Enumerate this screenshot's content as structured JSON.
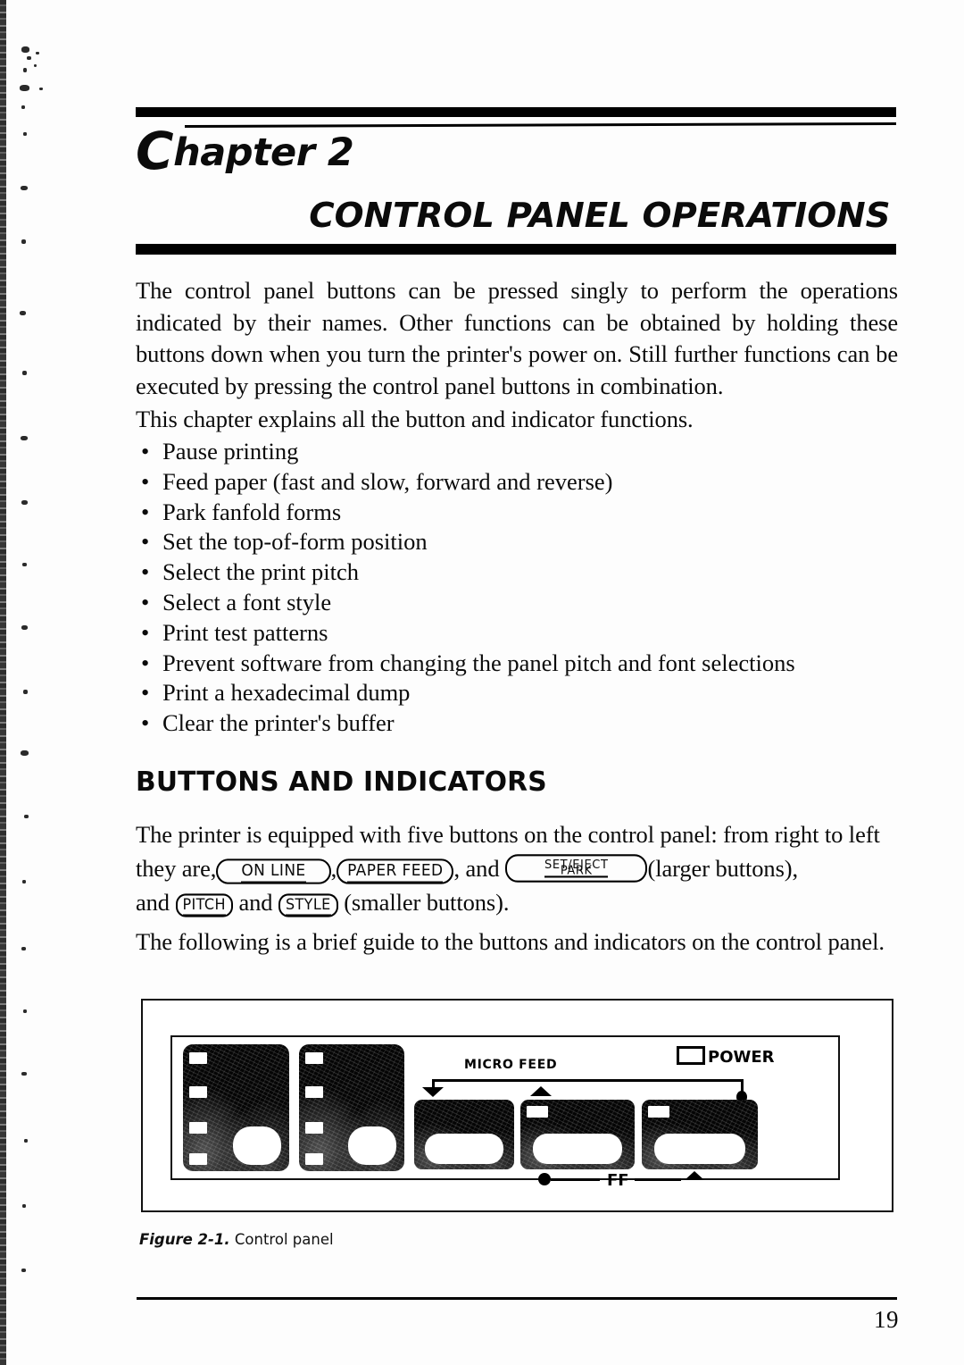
{
  "chapter": {
    "label_drop": "C",
    "label_rest": "hapter 2",
    "title": "CONTROL PANEL OPERATIONS"
  },
  "intro": {
    "paragraph_1": "The control panel buttons can be pressed singly to perform the operations indicated by their names. Other functions can be obtained by holding these buttons down when you turn the printer's power on. Still further functions can be executed by pressing the control panel buttons in combination.",
    "paragraph_2": "This chapter explains all the button and indicator functions."
  },
  "bullets": [
    "Pause printing",
    "Feed paper (fast and slow, forward and reverse)",
    "Park fanfold forms",
    "Set the top-of-form position",
    "Select the print pitch",
    "Select a font style",
    "Print test patterns",
    "Prevent software from changing the panel pitch and font selections",
    "Print a hexadecimal dump",
    "Clear the printer's buffer"
  ],
  "bullet_marker": "•",
  "section": {
    "heading": "BUTTONS AND INDICATORS",
    "para_lead": "The printer is equipped with five buttons on the control panel: from right to left they are,",
    "btn_online": "ON LINE",
    "sep_comma": ",",
    "btn_paperfeed": "PAPER FEED",
    "sep_and": ", and",
    "btn_set_eject": "SET/EJECT",
    "btn_park": "PARK",
    "after_large": "(larger buttons),",
    "and_word": "and",
    "btn_pitch": "PITCH",
    "and_word2": "and",
    "btn_style": "STYLE",
    "after_small": "(smaller buttons).",
    "para_follow": "The following is a brief guide to the buttons and indicators on the control panel."
  },
  "figure": {
    "label_micro_feed": "MICRO FEED",
    "label_power": "POWER",
    "label_ff": "FF",
    "caption_bold": "Figure 2-1.",
    "caption_rest": " Control panel"
  },
  "footer": {
    "page_number": "19"
  },
  "colors": {
    "ink": "#000000",
    "paper": "#fdfdfd"
  }
}
